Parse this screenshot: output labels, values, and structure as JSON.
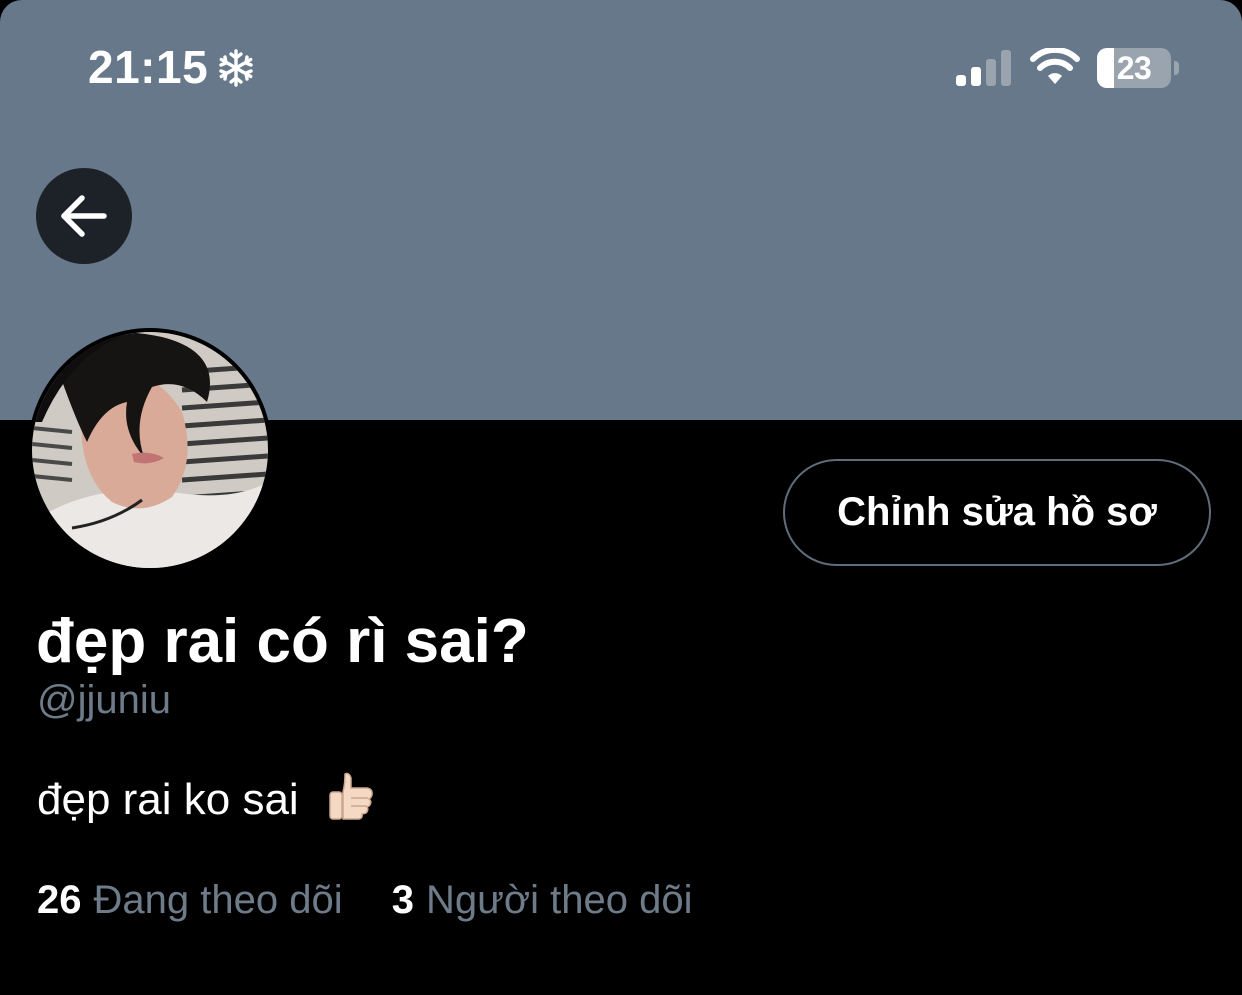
{
  "status_bar": {
    "time": "21:15",
    "focus_icon": "snowflake-icon",
    "signal_icon": "cellular-signal-icon",
    "wifi_icon": "wifi-icon",
    "battery_level": "23",
    "battery_fraction": 0.23
  },
  "header": {
    "back_icon": "arrow-left-icon",
    "banner_color": "#66788a"
  },
  "profile": {
    "avatar": "profile-photo",
    "edit_button_label": "Chỉnh sửa hồ sơ",
    "display_name": "đẹp rai có rì sai?",
    "handle": "@jjuniu",
    "bio_text": "đẹp rai ko sai",
    "bio_emoji": "thumbs-up-emoji"
  },
  "stats": {
    "following_count": "26",
    "following_label": "Đang theo dõi",
    "followers_count": "3",
    "followers_label": "Người theo dõi"
  },
  "colors": {
    "background": "#000000",
    "muted_text": "#6e7c8a",
    "primary_text": "#ffffff",
    "button_border": "#5f6d7a"
  }
}
